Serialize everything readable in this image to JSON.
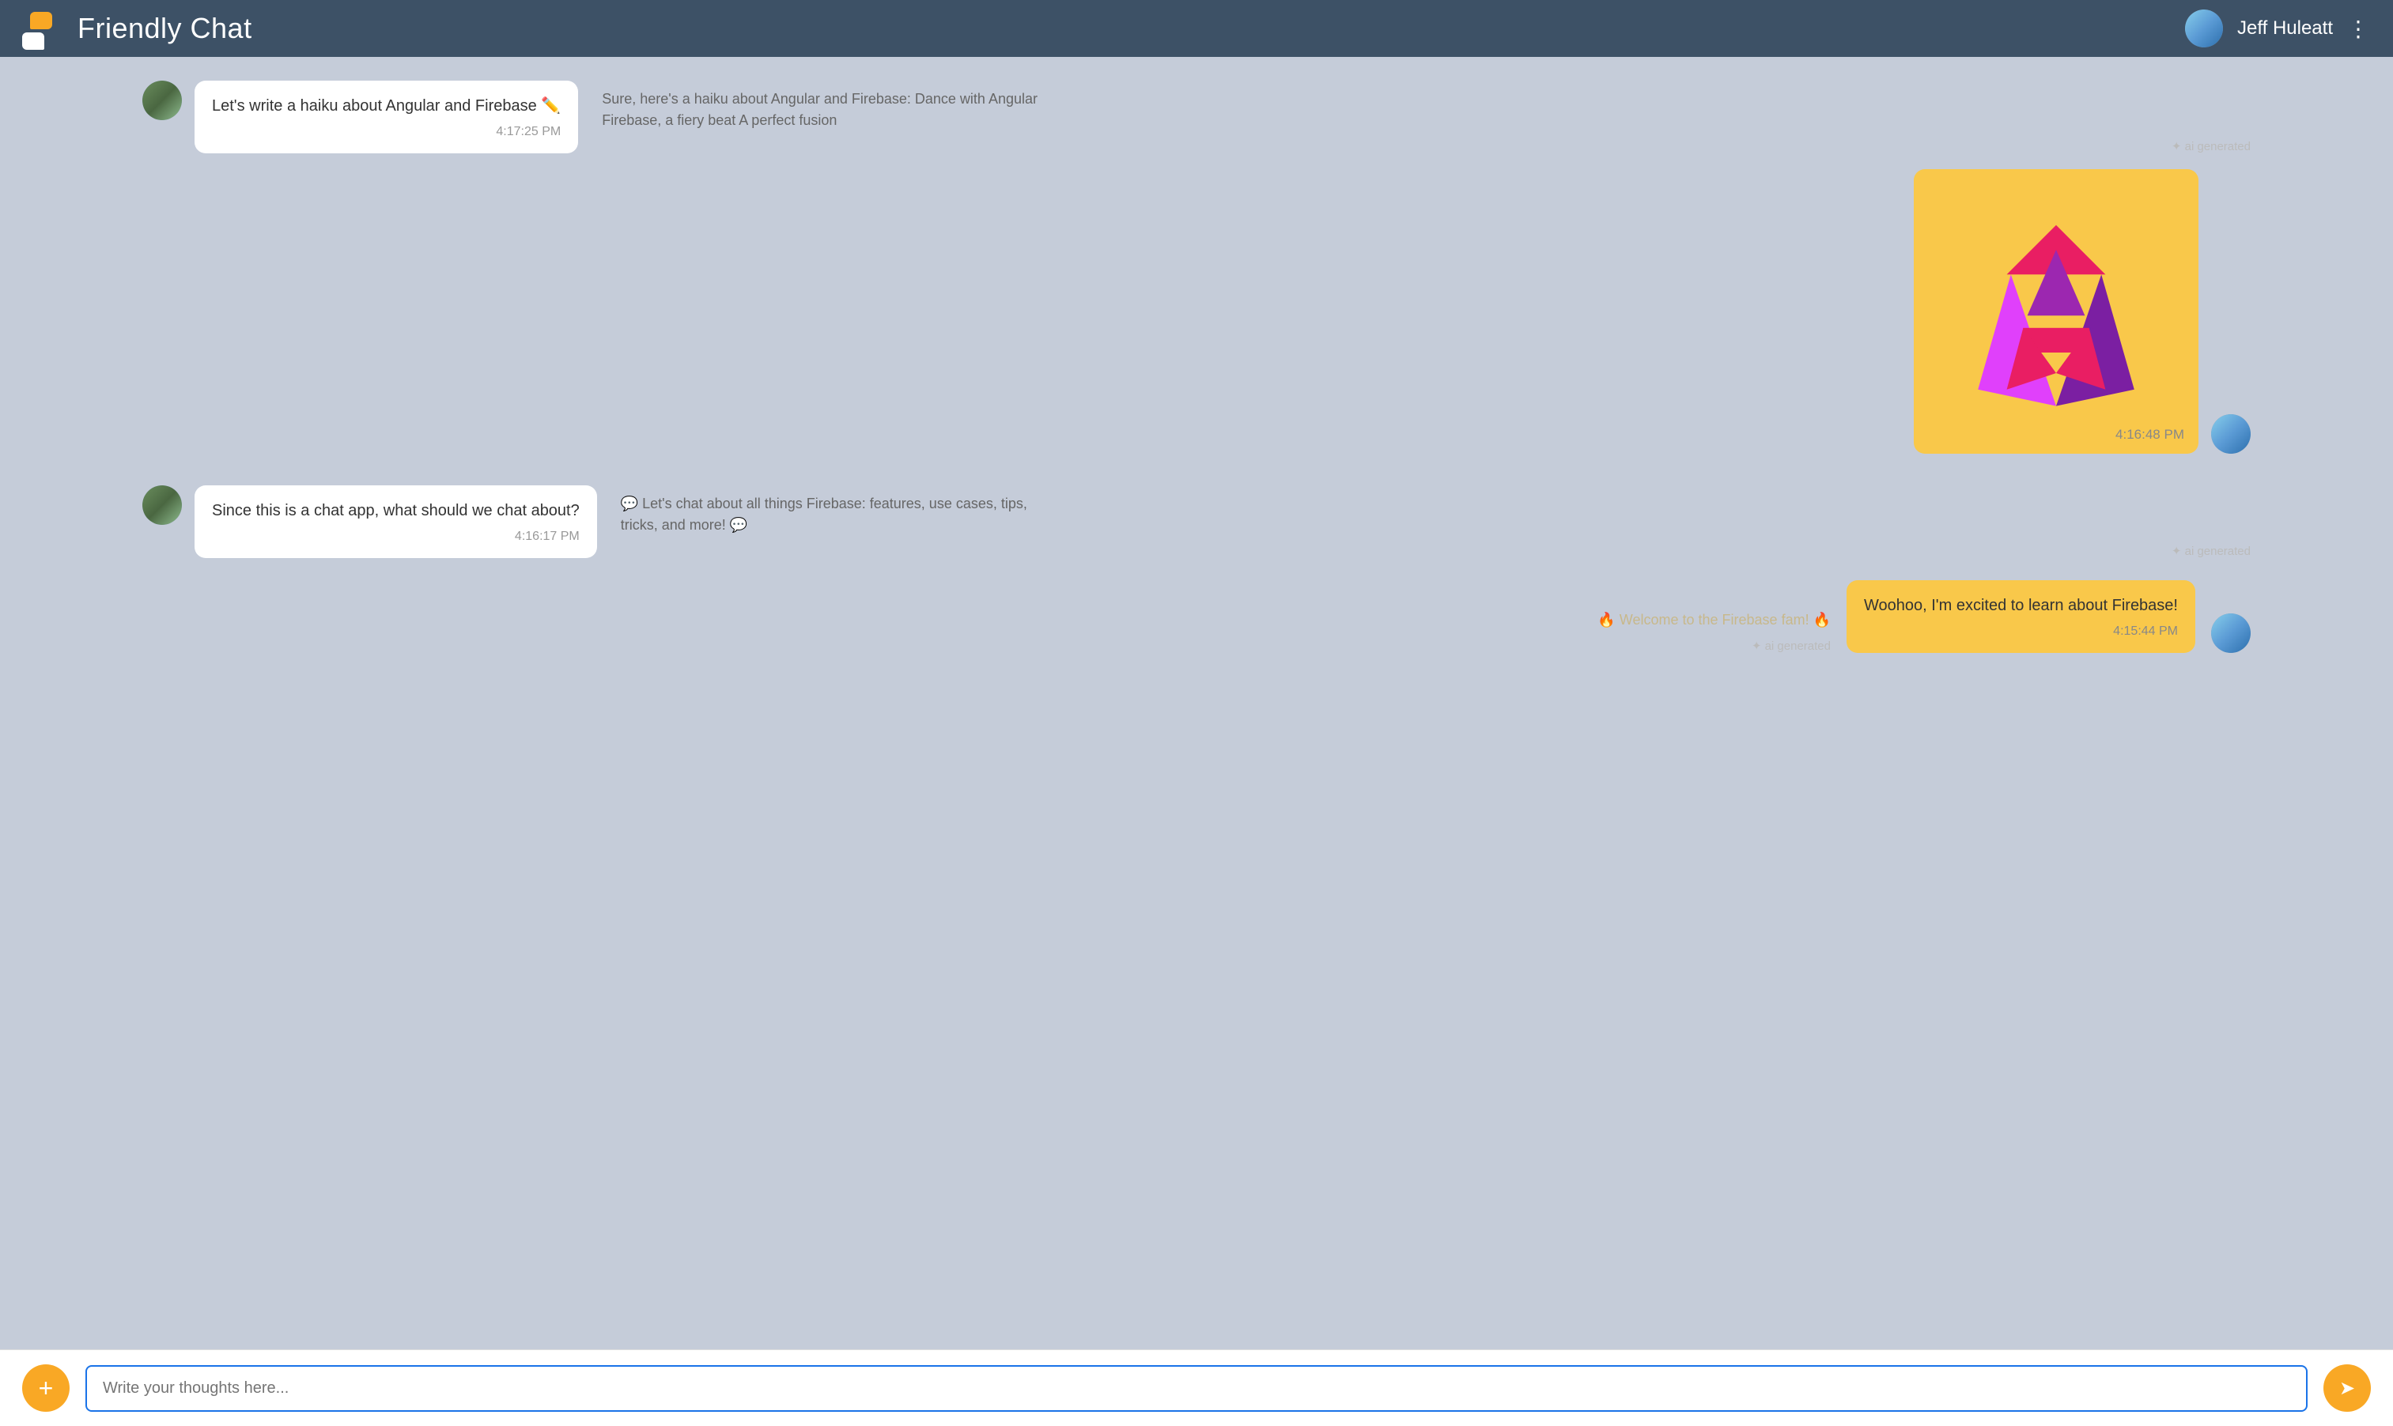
{
  "header": {
    "title": "Friendly Chat",
    "username": "Jeff Huleatt",
    "more_icon": "⋮"
  },
  "messages": [
    {
      "id": "msg1",
      "type": "received_with_ai",
      "bubble_text": "Let's write a haiku about Angular and Firebase ✏️",
      "bubble_time": "4:17:25 PM",
      "ai_text": "Sure, here's a haiku about Angular and Firebase: Dance with Angular Firebase, a fiery beat A perfect fusion",
      "ai_label": "✦ ai generated"
    },
    {
      "id": "msg2",
      "type": "sent_image",
      "time": "4:16:48 PM"
    },
    {
      "id": "msg3",
      "type": "received_with_ai",
      "bubble_text": "Since this is a chat app, what should we chat about?",
      "bubble_time": "4:16:17 PM",
      "ai_text": "💬 Let's chat about all things Firebase: features, use cases, tips, tricks, and more! 💬",
      "ai_label": "✦ ai generated"
    },
    {
      "id": "msg4",
      "type": "welcome_ai",
      "ai_text": "🔥 Welcome to the Firebase fam! 🔥",
      "ai_label": "✦ ai generated"
    },
    {
      "id": "msg5",
      "type": "sent_bubble",
      "bubble_text": "Woohoo, I'm excited to learn about Firebase!",
      "bubble_time": "4:15:44 PM"
    }
  ],
  "input": {
    "placeholder": "Write your thoughts here...",
    "add_label": "+",
    "send_label": "➤"
  }
}
